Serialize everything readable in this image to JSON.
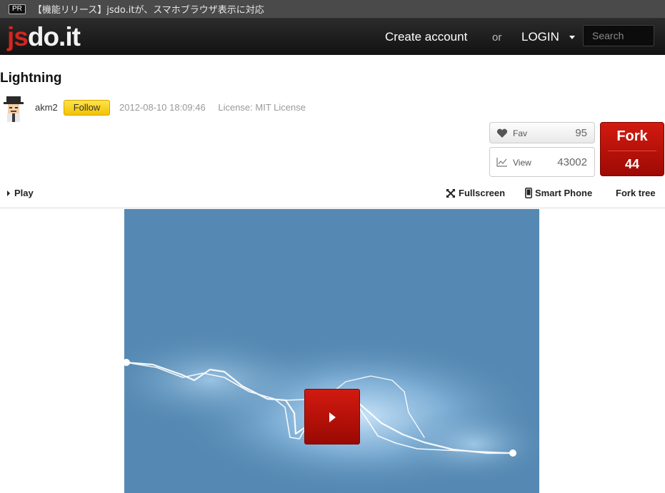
{
  "pr_bar": {
    "badge": "PR",
    "text": "【機能リリース】jsdo.itが、スマホブラウザ表示に対応"
  },
  "header": {
    "logo_j": "j",
    "logo_s": "s",
    "logo_rest": "do.it",
    "create_account": "Create account",
    "or": "or",
    "login": "LOGIN",
    "search_placeholder": "Search"
  },
  "code": {
    "title": "Lightning",
    "author": "akm2",
    "follow_label": "Follow",
    "date": "2012-08-10 18:09:46",
    "license": "License: MIT License"
  },
  "stats": {
    "fav_label": "Fav",
    "fav_count": "95",
    "view_label": "View",
    "view_count": "43002",
    "fork_label": "Fork",
    "fork_count": "44"
  },
  "toolbar": {
    "play": "Play",
    "fullscreen": "Fullscreen",
    "smart_phone": "Smart Phone",
    "fork_tree": "Fork tree"
  },
  "colors": {
    "accent_red": "#c4140b",
    "stage_bg": "#5589b3",
    "follow_yellow": "#f2c200"
  }
}
